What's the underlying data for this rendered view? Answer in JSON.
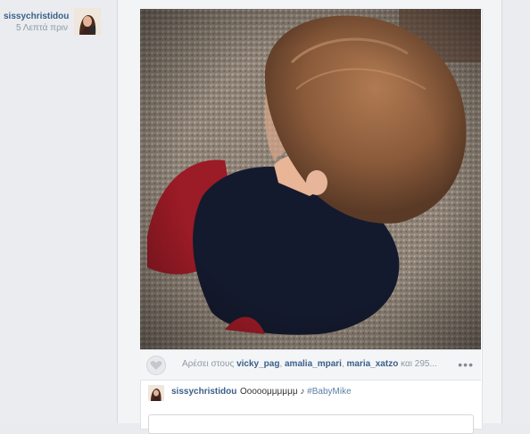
{
  "author": {
    "username": "sissychristidou",
    "time": "5 Λεπτά πριν"
  },
  "post": {
    "likes": {
      "prefix": "Αρέσει στους",
      "users": [
        "vicky_pag",
        "amalia_mpari",
        "maria_xatzo"
      ],
      "suffix": "και 295..."
    },
    "more_label": "•••",
    "caption": {
      "username": "sissychristidou",
      "text": "Οοοοομμμμμμ ",
      "emoji": "♪ ",
      "hashtag": "#BabyMike"
    }
  },
  "icons": {
    "like": "heart-icon",
    "more": "more-options-icon"
  },
  "colors": {
    "link": "#3a5f89",
    "muted": "#8e9aa5",
    "background": "#e9ebee"
  }
}
